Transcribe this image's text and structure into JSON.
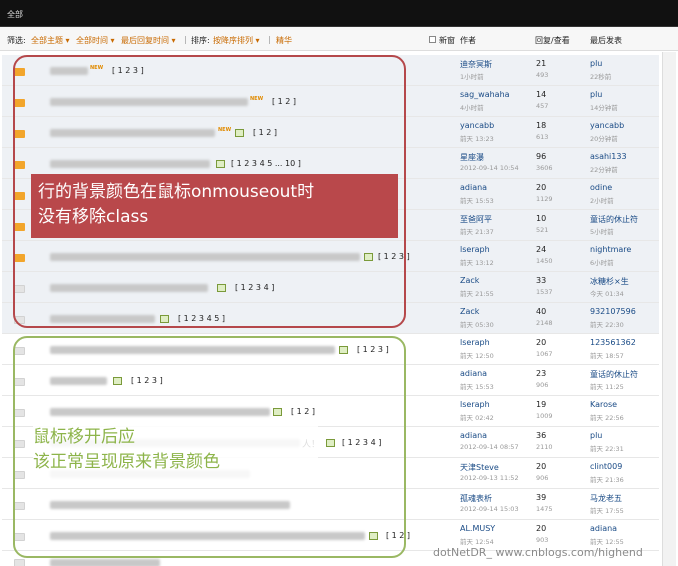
{
  "topbar": {
    "tab": "全部"
  },
  "filter": {
    "label": "筛选:",
    "theme": "全部主题 ▾",
    "time": "全部时间 ▾",
    "last_reply": "最后回复时间 ▾",
    "sort_label": "排序:",
    "sort_order": "按降序排列 ▾",
    "digest": "精华",
    "new_window": "新窗",
    "col_author": "作者",
    "col_reply_view": "回复/查看",
    "col_last_post": "最后发表"
  },
  "rows": [
    {
      "pages": "[ 1 2 3 ]",
      "author": "迪奈冥斯",
      "author_time": "1小时前",
      "replies": "21",
      "views": "493",
      "last_user": "plu",
      "last_time": "22秒前"
    },
    {
      "pages": "[ 1 2 ]",
      "author": "sag_wahaha",
      "author_time": "4小时前",
      "replies": "14",
      "views": "457",
      "last_user": "plu",
      "last_time": "14分钟前"
    },
    {
      "pages": "[ 1 2 ]",
      "author": "yancabb",
      "author_time": "前天 13:23",
      "replies": "18",
      "views": "613",
      "last_user": "yancabb",
      "last_time": "20分钟前"
    },
    {
      "pages": "[ 1 2 3 4 5 ... 10 ]",
      "author": "星座瀑",
      "author_time": "2012-09-14 10:54",
      "replies": "96",
      "views": "3606",
      "last_user": "asahi133",
      "last_time": "22分钟前"
    },
    {
      "pages": "",
      "author": "adiana",
      "author_time": "前天 15:53",
      "replies": "20",
      "views": "1129",
      "last_user": "odine",
      "last_time": "2小时前"
    },
    {
      "pages": "",
      "author": "至爸阿平",
      "author_time": "前天 21:37",
      "replies": "10",
      "views": "521",
      "last_user": "童话的休止符",
      "last_time": "5小时前"
    },
    {
      "pages": "[ 1 2 3 ]",
      "author": "lseraph",
      "author_time": "前天 13:12",
      "replies": "24",
      "views": "1450",
      "last_user": "nightmare",
      "last_time": "6小时前"
    },
    {
      "pages": "[ 1 2 3 4 ]",
      "author": "Zack",
      "author_time": "前天 21:55",
      "replies": "33",
      "views": "1537",
      "last_user": "冰糖杉×生",
      "last_time": "今天 01:34"
    },
    {
      "pages": "[ 1 2 3 4 5 ]",
      "author": "Zack",
      "author_time": "前天 05:30",
      "replies": "40",
      "views": "2148",
      "last_user": "932107596",
      "last_time": "前天 22:30"
    },
    {
      "pages": "[ 1 2 3 ]",
      "author": "lseraph",
      "author_time": "前天 12:50",
      "replies": "20",
      "views": "1067",
      "last_user": "123561362",
      "last_time": "前天 18:57"
    },
    {
      "pages": "[ 1 2 3 ]",
      "author": "adiana",
      "author_time": "前天 15:53",
      "replies": "23",
      "views": "906",
      "last_user": "童话的休止符",
      "last_time": "前天 11:25"
    },
    {
      "pages": "[ 1 2 ]",
      "author": "lseraph",
      "author_time": "前天 02:42",
      "replies": "19",
      "views": "1009",
      "last_user": "Karose",
      "last_time": "前天 22:56"
    },
    {
      "pages": "[ 1 2 3 4 ]",
      "author": "adiana",
      "author_time": "2012-09-14 08:57",
      "replies": "36",
      "views": "2110",
      "last_user": "plu",
      "last_time": "前天 22:31"
    },
    {
      "pages": "",
      "author": "天津Steve",
      "author_time": "2012-09-13 11:52",
      "replies": "20",
      "views": "906",
      "last_user": "clint009",
      "last_time": "前天 21:36"
    },
    {
      "pages": "",
      "author": "孤魂表析",
      "author_time": "2012-09-14 15:03",
      "replies": "39",
      "views": "1475",
      "last_user": "马龙老五",
      "last_time": "前天 17:55"
    },
    {
      "pages": "[ 1 2 ]",
      "author": "AL.MUSY",
      "author_time": "前天 12:54",
      "replies": "20",
      "views": "903",
      "last_user": "adiana",
      "last_time": "前天 12:55"
    }
  ],
  "annotations": {
    "red_line1": "行的背景颜色在鼠标onmouseout时",
    "red_line2": "没有移除class",
    "green_line1": "鼠标移开后应",
    "green_line2": "该正常呈现原来背景颜色"
  },
  "row13_title_tail": "人！",
  "watermark": "dotNetDR_ www.cnblogs.com/highend"
}
